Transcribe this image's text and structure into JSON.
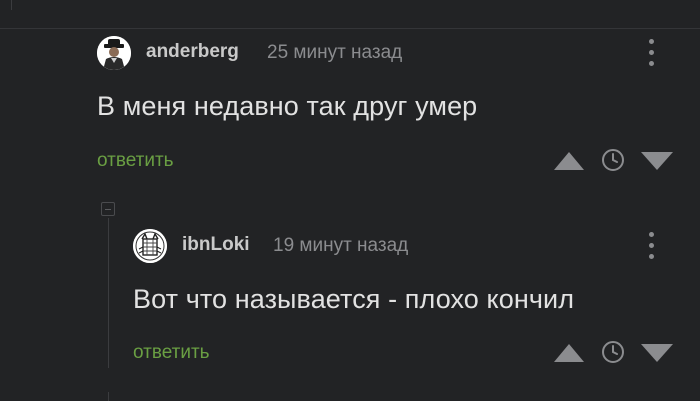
{
  "comments": [
    {
      "username": "anderberg",
      "time": "25 минут назад",
      "text": "В меня недавно так друг умер",
      "reply_label": "ответить",
      "avatar": "man-in-hat-avatar"
    },
    {
      "username": "ibnLoki",
      "time": "19 минут назад",
      "text": "Вот что называется - плохо кончил",
      "reply_label": "ответить",
      "avatar": "cat-sketch-avatar"
    }
  ],
  "icons": {
    "more": "vertical-dots-icon",
    "upvote": "triangle-up-icon",
    "save": "clock-icon",
    "downvote": "triangle-down-icon",
    "collapse": "collapse-box-icon"
  },
  "colors": {
    "background": "#222325",
    "reply_link": "#6a9f43",
    "muted": "#8b8c8f",
    "text": "#e2e2e2"
  }
}
